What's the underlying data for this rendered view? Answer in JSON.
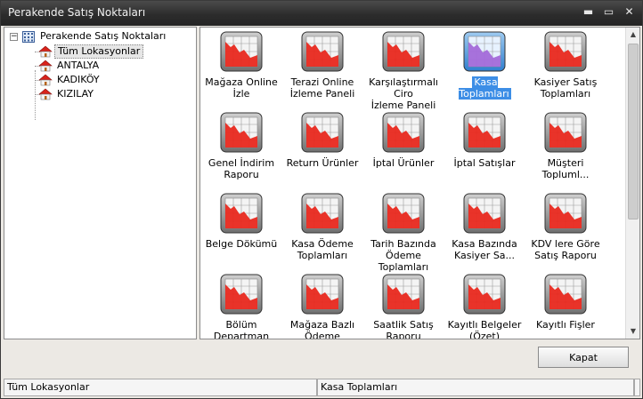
{
  "window": {
    "title": "Perakende Satış Noktaları",
    "controls": {
      "minimize": "▬",
      "maximize": "▭",
      "close": "✕"
    }
  },
  "tree": {
    "expander": "−",
    "root": "Perakende Satış Noktaları",
    "children": [
      "Tüm Lokasyonlar",
      "ANTALYA",
      "KADIKÖY",
      "KIZILAY"
    ],
    "selected_index": 0
  },
  "icon_grid": {
    "items": [
      "Mağaza Online\nİzle",
      "Terazi Online\nİzleme Paneli",
      "Karşılaştırmalı Ciro\nİzleme Paneli",
      "Kasa Toplamları",
      "Kasiyer Satış\nToplamları",
      "Genel İndirim\nRaporu",
      "Return Ürünler",
      "İptal Ürünler",
      "İptal Satışlar",
      "Müşteri Topluml...",
      "Belge Dökümü",
      "Kasa Ödeme\nToplamları",
      "Tarih Bazında\nÖdeme Toplamları",
      "Kasa Bazında\nKasiyer Sa...",
      "KDV lere Göre\nSatış Raporu",
      "Bölüm Departman\nSatışları",
      "Mağaza Bazlı\nÖdeme Toplamları",
      "Saatlik Satış\nRaporu",
      "Kayıtlı Belgeler\n(Özet)",
      "Kayıtlı Fişler"
    ],
    "selected_index": 3
  },
  "buttons": {
    "close_label": "Kapat"
  },
  "scrollbar": {
    "up": "▲",
    "down": "▼"
  },
  "status": {
    "left": "Tüm Lokasyonlar",
    "middle": "Kasa Toplamları",
    "right": ""
  },
  "colors": {
    "selection": "#3d8ee6",
    "report_tile_red": "#e8281e",
    "titlebar": "#2c2c2c"
  },
  "icons": {
    "tree_root": "building-grid-icon",
    "tree_child": "house-icon",
    "report": "report-chart-icon"
  }
}
